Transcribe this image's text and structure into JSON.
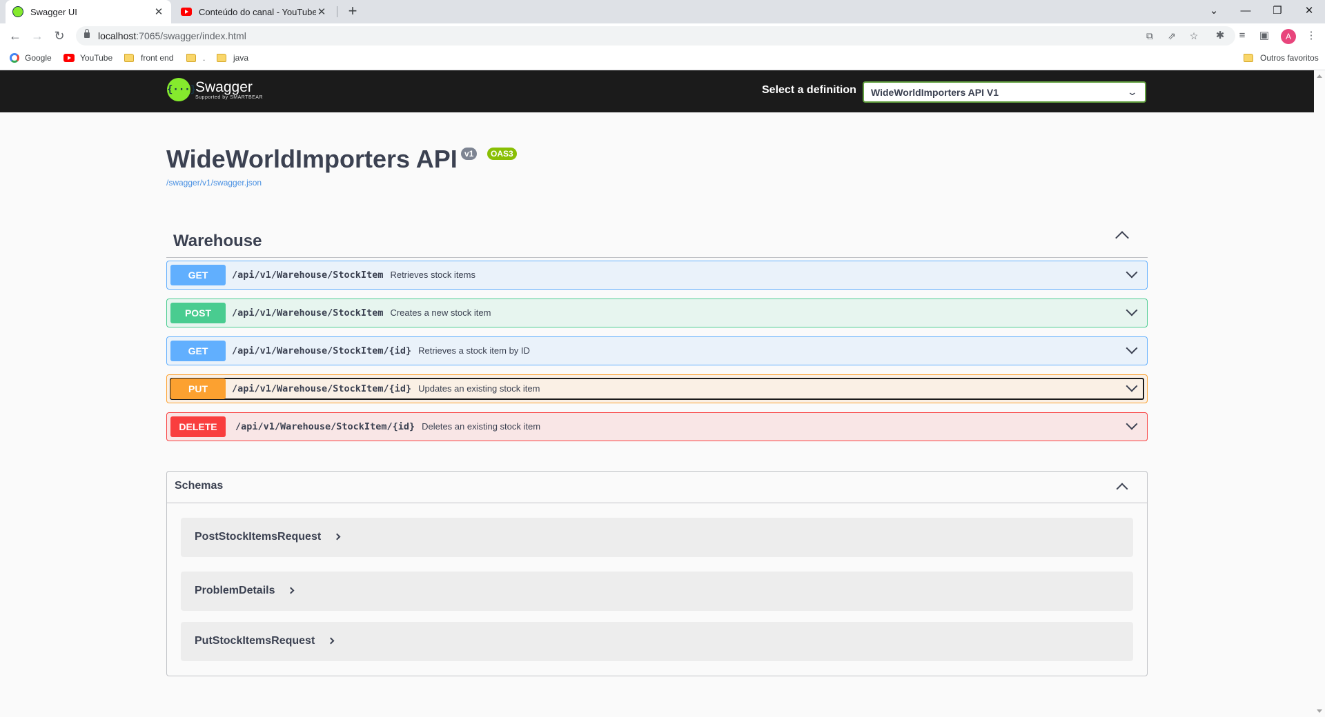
{
  "browser": {
    "tabs": [
      {
        "title": "Swagger UI",
        "active": true,
        "icon": "swagger-favicon"
      },
      {
        "title": "Conteúdo do canal - YouTube St...",
        "active": false,
        "icon": "youtube-favicon"
      }
    ],
    "url_host": "localhost",
    "url_path": ":7065/swagger/index.html",
    "bookmarks": [
      {
        "label": "Google",
        "icon": "google-icon"
      },
      {
        "label": "YouTube",
        "icon": "youtube-icon"
      },
      {
        "label": "front end",
        "icon": "folder-icon"
      },
      {
        "label": ".",
        "icon": "folder-icon"
      },
      {
        "label": "java",
        "icon": "folder-icon"
      }
    ],
    "other_bookmarks": "Outros favoritos",
    "profile_initial": "A"
  },
  "topbar": {
    "logo_name": "Swagger",
    "logo_sub": "Supported by SMARTBEAR",
    "definition_label": "Select a definition",
    "definition_value": "WideWorldImporters API V1"
  },
  "info": {
    "title": "WideWorldImporters API",
    "version": "v1",
    "oas": "OAS3",
    "spec_link": "/swagger/v1/swagger.json"
  },
  "section": {
    "title": "Warehouse",
    "operations": [
      {
        "method": "GET",
        "path": "/api/v1/Warehouse/StockItem",
        "summary": "Retrieves stock items"
      },
      {
        "method": "POST",
        "path": "/api/v1/Warehouse/StockItem",
        "summary": "Creates a new stock item"
      },
      {
        "method": "GET",
        "path": "/api/v1/Warehouse/StockItem/{id}",
        "summary": "Retrieves a stock item by ID"
      },
      {
        "method": "PUT",
        "path": "/api/v1/Warehouse/StockItem/{id}",
        "summary": "Updates an existing stock item"
      },
      {
        "method": "DELETE",
        "path": "/api/v1/Warehouse/StockItem/{id}",
        "summary": "Deletes an existing stock item"
      }
    ]
  },
  "schemas": {
    "title": "Schemas",
    "models": [
      "PostStockItemsRequest",
      "ProblemDetails",
      "PutStockItemsRequest"
    ]
  },
  "colors": {
    "get": "#61affe",
    "post": "#49cc90",
    "put": "#fca130",
    "delete": "#f93e3e",
    "topbar_bg": "#1b1b1b",
    "accent": "#85ea2d"
  }
}
